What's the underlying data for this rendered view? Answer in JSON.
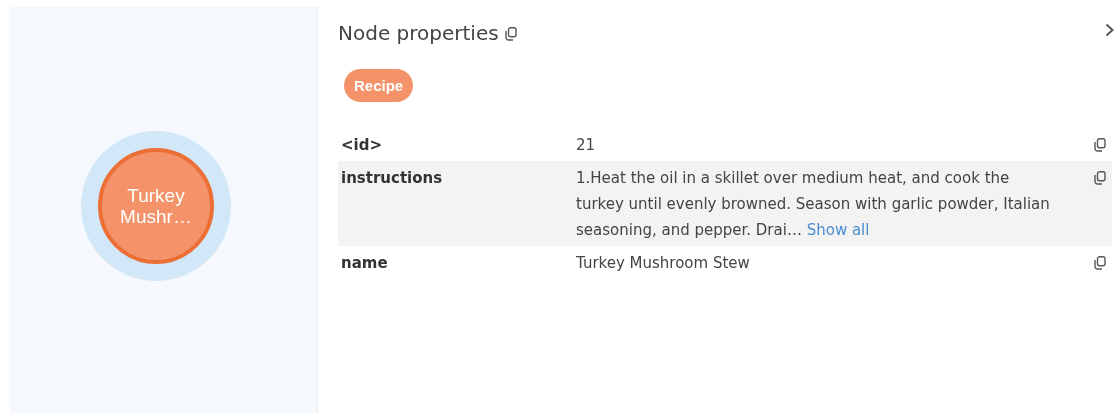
{
  "canvas": {
    "node": {
      "label": "Turkey\nMushr…",
      "selected": true
    }
  },
  "panel": {
    "title": "Node properties",
    "labels": [
      {
        "text": "Recipe",
        "color": "#f4936a"
      }
    ],
    "properties": [
      {
        "key": "<id>",
        "value": "21"
      },
      {
        "key": "instructions",
        "value": "1.Heat the oil in a skillet over medium heat, and cook the turkey until evenly browned. Season with garlic powder, Italian seasoning, and pepper. Drai…",
        "link": "Show all"
      },
      {
        "key": "name",
        "value": "Turkey Mushroom Stew"
      }
    ]
  }
}
